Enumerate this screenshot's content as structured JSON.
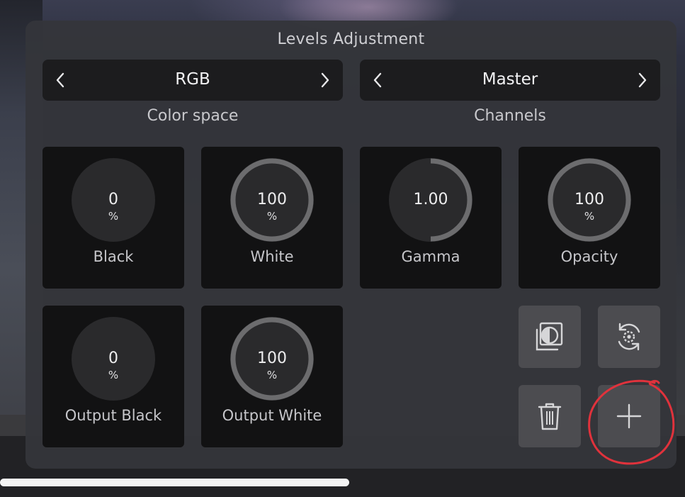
{
  "panel": {
    "title": "Levels Adjustment"
  },
  "color_space": {
    "value": "RGB",
    "caption": "Color space"
  },
  "channels": {
    "value": "Master",
    "caption": "Channels"
  },
  "dials": [
    {
      "label": "Black",
      "value": "0",
      "unit": "%",
      "level": 0
    },
    {
      "label": "White",
      "value": "100",
      "unit": "%",
      "level": 1
    },
    {
      "label": "Gamma",
      "value": "1.00",
      "unit": "",
      "level": 0.5
    },
    {
      "label": "Opacity",
      "value": "100",
      "unit": "%",
      "level": 1
    },
    {
      "label": "Output Black",
      "value": "0",
      "unit": "%",
      "level": 0
    },
    {
      "label": "Output White",
      "value": "100",
      "unit": "%",
      "level": 1
    }
  ],
  "actions": {
    "mask_icon": "layer-mask-icon",
    "reset_icon": "reset-gear-icon",
    "delete_icon": "trash-icon",
    "add_icon": "plus-icon"
  },
  "colors": {
    "panel": "#343539",
    "tile": "#121213",
    "dial_face": "#2a2a2c",
    "dial_ring": "#6c6c6e",
    "annotation": "#e0323c"
  }
}
